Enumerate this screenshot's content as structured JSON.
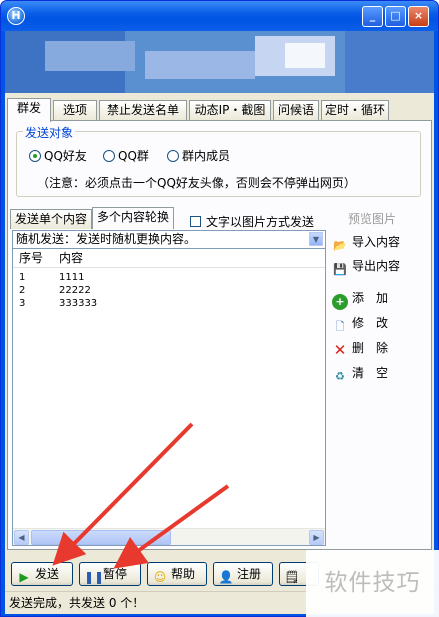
{
  "window": {
    "app_icon_text": "H",
    "buttons": {
      "minimize": "_",
      "maximize": "□",
      "close": "×"
    }
  },
  "tabs": [
    {
      "label": "群发"
    },
    {
      "label": "选项"
    },
    {
      "label": "禁止发送名单"
    },
    {
      "label": "动态IP・截图"
    },
    {
      "label": "问候语"
    },
    {
      "label": "定时・循环"
    }
  ],
  "target_group": {
    "title": "发送对象",
    "options": [
      {
        "label": "QQ好友",
        "selected": true
      },
      {
        "label": "QQ群",
        "selected": false
      },
      {
        "label": "群内成员",
        "selected": false
      }
    ],
    "note": "（注意：必须点击一个QQ好友头像，否则会不停弹出网页）"
  },
  "content_tabs": [
    {
      "label": "发送单个内容"
    },
    {
      "label": "多个内容轮换"
    }
  ],
  "image_mode": {
    "label": "文字以图片方式发送",
    "checked": false
  },
  "mode_select": {
    "value": "随机发送：发送时随机更换内容。"
  },
  "list": {
    "headers": [
      "序号",
      "内容"
    ],
    "rows": [
      {
        "id": "1",
        "content": "1111"
      },
      {
        "id": "2",
        "content": "22222"
      },
      {
        "id": "3",
        "content": "333333"
      }
    ]
  },
  "side_actions": {
    "preview": "预览图片",
    "import": "导入内容",
    "export": "导出内容",
    "add": "添　加",
    "edit": "修　改",
    "delete": "删　除",
    "clear": "清　空"
  },
  "bottom_buttons": {
    "send": "发送",
    "pause": "暂停",
    "help": "帮助",
    "register": "注册"
  },
  "status": "发送完成，共发送 0 个！",
  "watermark": "软件技巧",
  "colors": {
    "titlebar": "#0054e3",
    "face": "#ece9d8",
    "arrows": "#e8392e",
    "group_title": "#0046d5"
  }
}
